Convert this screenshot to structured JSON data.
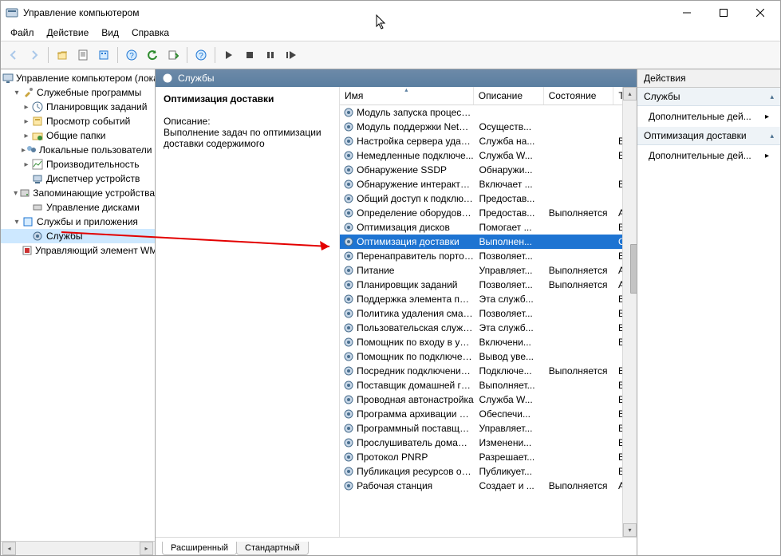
{
  "window": {
    "title": "Управление компьютером"
  },
  "menu": {
    "file": "Файл",
    "action": "Действие",
    "view": "Вид",
    "help": "Справка"
  },
  "tree": {
    "root": "Управление компьютером (локаль",
    "groups": {
      "systemTools": "Служебные программы",
      "storage": "Запоминающие устройства",
      "servicesApps": "Службы и приложения"
    },
    "items": {
      "taskScheduler": "Планировщик заданий",
      "eventViewer": "Просмотр событий",
      "sharedFolders": "Общие папки",
      "localUsers": "Локальные пользователи и",
      "performance": "Производительность",
      "deviceManager": "Диспетчер устройств",
      "diskMgmt": "Управление дисками",
      "services": "Службы",
      "wmiControl": "Управляющий элемент WM"
    }
  },
  "center": {
    "bannerTitle": "Службы",
    "detail": {
      "title": "Оптимизация доставки",
      "descLabel": "Описание:",
      "descText": "Выполнение задач по оптимизации доставки содержимого"
    },
    "columns": {
      "name": "Имя",
      "desc": "Описание",
      "state": "Состояние",
      "start": "Ти"
    },
    "tabs": {
      "extended": "Расширенный",
      "standard": "Стандартный"
    }
  },
  "services": [
    {
      "n": "Модуль запуска процессо...",
      "d": "",
      "s": "",
      "t": ""
    },
    {
      "n": "Модуль поддержки NetBI...",
      "d": "Осуществ...",
      "s": "",
      "t": ""
    },
    {
      "n": "Настройка сервера удален...",
      "d": "Служба на...",
      "s": "",
      "t": "Вр"
    },
    {
      "n": "Немедленные подключе...",
      "d": "Служба W...",
      "s": "",
      "t": "Вр"
    },
    {
      "n": "Обнаружение SSDP",
      "d": "Обнаружи...",
      "s": "",
      "t": ""
    },
    {
      "n": "Обнаружение интерактив...",
      "d": "Включает ...",
      "s": "",
      "t": "Вр"
    },
    {
      "n": "Общий доступ к подключ...",
      "d": "Предостав...",
      "s": "",
      "t": ""
    },
    {
      "n": "Определение оборудован...",
      "d": "Предостав...",
      "s": "Выполняется",
      "t": "А"
    },
    {
      "n": "Оптимизация дисков",
      "d": "Помогает ...",
      "s": "",
      "t": "Вр"
    },
    {
      "n": "Оптимизация доставки",
      "d": "Выполнен...",
      "s": "",
      "t": "О",
      "sel": true
    },
    {
      "n": "Перенаправитель портов ...",
      "d": "Позволяет...",
      "s": "",
      "t": "Вр"
    },
    {
      "n": "Питание",
      "d": "Управляет...",
      "s": "Выполняется",
      "t": "А"
    },
    {
      "n": "Планировщик заданий",
      "d": "Позволяет...",
      "s": "Выполняется",
      "t": "А"
    },
    {
      "n": "Поддержка элемента пане...",
      "d": "Эта служб...",
      "s": "",
      "t": "Вр"
    },
    {
      "n": "Политика удаления смарт...",
      "d": "Позволяет...",
      "s": "",
      "t": "Вр"
    },
    {
      "n": "Пользовательская служба...",
      "d": "Эта служб...",
      "s": "",
      "t": "Вр"
    },
    {
      "n": "Помощник по входу в уче...",
      "d": "Включени...",
      "s": "",
      "t": "Вр"
    },
    {
      "n": "Помощник по подключен...",
      "d": "Вывод уве...",
      "s": "",
      "t": ""
    },
    {
      "n": "Посредник подключений ...",
      "d": "Подключе...",
      "s": "Выполняется",
      "t": "Вр"
    },
    {
      "n": "Поставщик домашней гру...",
      "d": "Выполняет...",
      "s": "",
      "t": "Вр"
    },
    {
      "n": "Проводная автонастройка",
      "d": "Служба W...",
      "s": "",
      "t": "Вр"
    },
    {
      "n": "Программа архивации да...",
      "d": "Обеспечи...",
      "s": "",
      "t": "Вр"
    },
    {
      "n": "Программный поставщик...",
      "d": "Управляет...",
      "s": "",
      "t": "Вр"
    },
    {
      "n": "Прослушиватель домашн...",
      "d": "Изменени...",
      "s": "",
      "t": "Вр"
    },
    {
      "n": "Протокол PNRP",
      "d": "Разрешает...",
      "s": "",
      "t": "Вр"
    },
    {
      "n": "Публикация ресурсов об...",
      "d": "Публикует...",
      "s": "",
      "t": "Вр"
    },
    {
      "n": "Рабочая станция",
      "d": "Создает и ...",
      "s": "Выполняется",
      "t": "А"
    }
  ],
  "actions": {
    "header": "Действия",
    "section1": "Службы",
    "more": "Дополнительные дей...",
    "section2": "Оптимизация доставки"
  }
}
